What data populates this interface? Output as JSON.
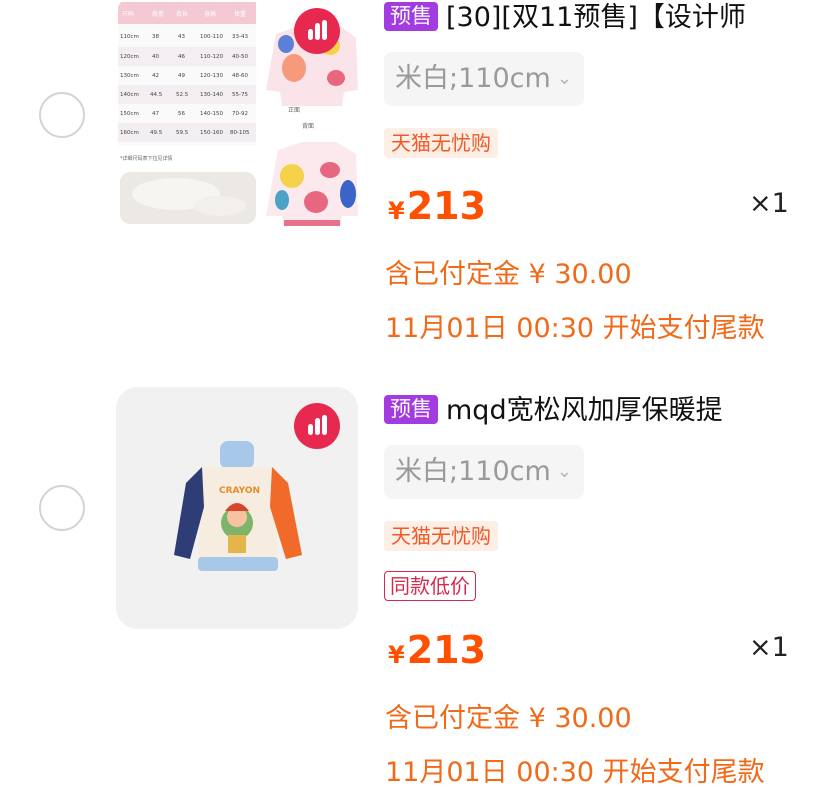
{
  "colors": {
    "price": "#ff4f00",
    "deposit_text": "#f06a1a",
    "presale_tag_bg": "#a23be0",
    "tmall_tag_bg": "#fdeee6",
    "tmall_tag_text": "#ef5a28",
    "low_price_tag": "#d62a4d",
    "tmall_badge": "#e8294f"
  },
  "items": [
    {
      "thumb_icon": "size-chart-and-jacket-photo",
      "badge_icon": "tmall-logo-icon",
      "presale_tag": "预售",
      "title": "[30][双11预售]【设计师",
      "sku": "米白;110cm",
      "sku_icon": "chevron-down-icon",
      "tmall_tag": "天猫无忧购",
      "currency": "¥",
      "price": "213",
      "qty": "×1",
      "deposit": "含已付定金 ¥ 30.00",
      "pay_time": "11月01日 00:30 开始支付尾款",
      "size_chart": {
        "headers": [
          "尺码",
          "肩宽",
          "衣长",
          "身高",
          "体重"
        ],
        "rows": [
          [
            "110cm",
            "38",
            "43",
            "100-110",
            "33-43"
          ],
          [
            "120cm",
            "40",
            "46",
            "110-120",
            "40-50"
          ],
          [
            "130cm",
            "42",
            "49",
            "120-130",
            "48-60"
          ],
          [
            "140cm",
            "44.5",
            "52.5",
            "130-140",
            "55-75"
          ],
          [
            "150cm",
            "47",
            "56",
            "140-150",
            "70-92"
          ],
          [
            "160cm",
            "49.5",
            "59.5",
            "150-160",
            "80-105"
          ]
        ],
        "note": "*详细尺码表下拉见详情",
        "front_label": "正面",
        "back_label": "背面"
      }
    },
    {
      "thumb_icon": "kids-sweater-photo",
      "badge_icon": "tmall-logo-icon",
      "presale_tag": "预售",
      "title": "mqd宽松风加厚保暖提",
      "sku": "米白;110cm",
      "sku_icon": "chevron-down-icon",
      "tmall_tag": "天猫无忧购",
      "low_price_tag": "同款低价",
      "currency": "¥",
      "price": "213",
      "qty": "×1",
      "deposit": "含已付定金 ¥ 30.00",
      "pay_time": "11月01日 00:30 开始支付尾款",
      "sweater_text": "CRAYON"
    }
  ]
}
